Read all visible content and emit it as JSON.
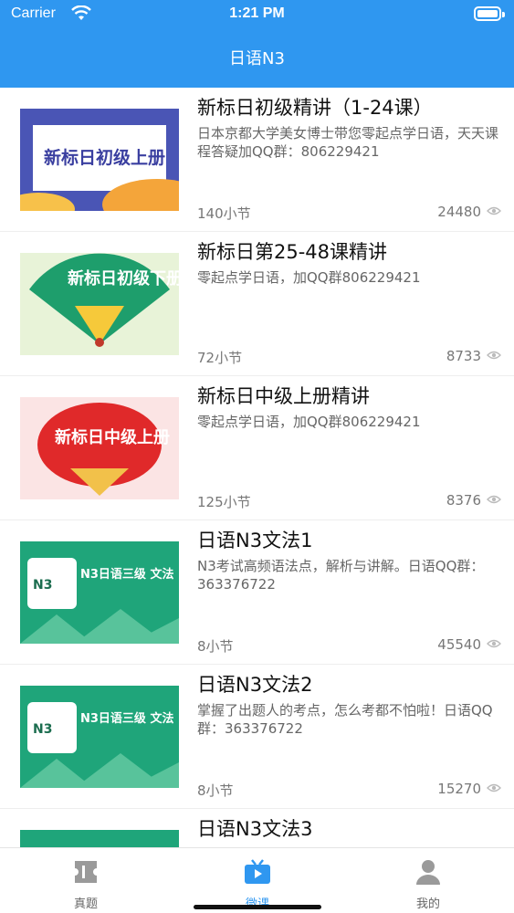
{
  "status_bar": {
    "carrier": "Carrier",
    "time": "1:21 PM"
  },
  "nav": {
    "title": "日语N3"
  },
  "courses": [
    {
      "title": "新标日初级精讲（1-24课）",
      "description": "日本京都大学美女博士带您零起点学日语，天天课程答疑加QQ群：806229421",
      "lessons": "140小节",
      "views": "24480",
      "thumb_text": "新标日初级上册"
    },
    {
      "title": "新标日第25-48课精讲",
      "description": "零起点学日语，加QQ群806229421",
      "lessons": "72小节",
      "views": "8733",
      "thumb_text": "新标日初级下册"
    },
    {
      "title": "新标日中级上册精讲",
      "description": "零起点学日语，加QQ群806229421",
      "lessons": "125小节",
      "views": "8376",
      "thumb_text": "新标日中级上册"
    },
    {
      "title": "日语N3文法1",
      "description": "N3考试高频语法点，解析与讲解。日语QQ群：363376722",
      "lessons": "8小节",
      "views": "45540",
      "thumb_text": "N3日语三级 文法"
    },
    {
      "title": "日语N3文法2",
      "description": "掌握了出题人的考点，怎么考都不怕啦！日语QQ群：363376722",
      "lessons": "8小节",
      "views": "15270",
      "thumb_text": "N3日语三级 文法"
    },
    {
      "title": "日语N3文法3",
      "description": "",
      "lessons": "",
      "views": "",
      "thumb_text": ""
    }
  ],
  "tabs": [
    {
      "label": "真题",
      "icon": "ticket-icon",
      "active": false
    },
    {
      "label": "微课",
      "icon": "tv-icon",
      "active": true
    },
    {
      "label": "我的",
      "icon": "user-icon",
      "active": false
    }
  ],
  "colors": {
    "primary": "#2f97f0",
    "fan_green": "#1e9e6c",
    "fan_red": "#e0292a",
    "n3_green": "#1fa57a"
  }
}
